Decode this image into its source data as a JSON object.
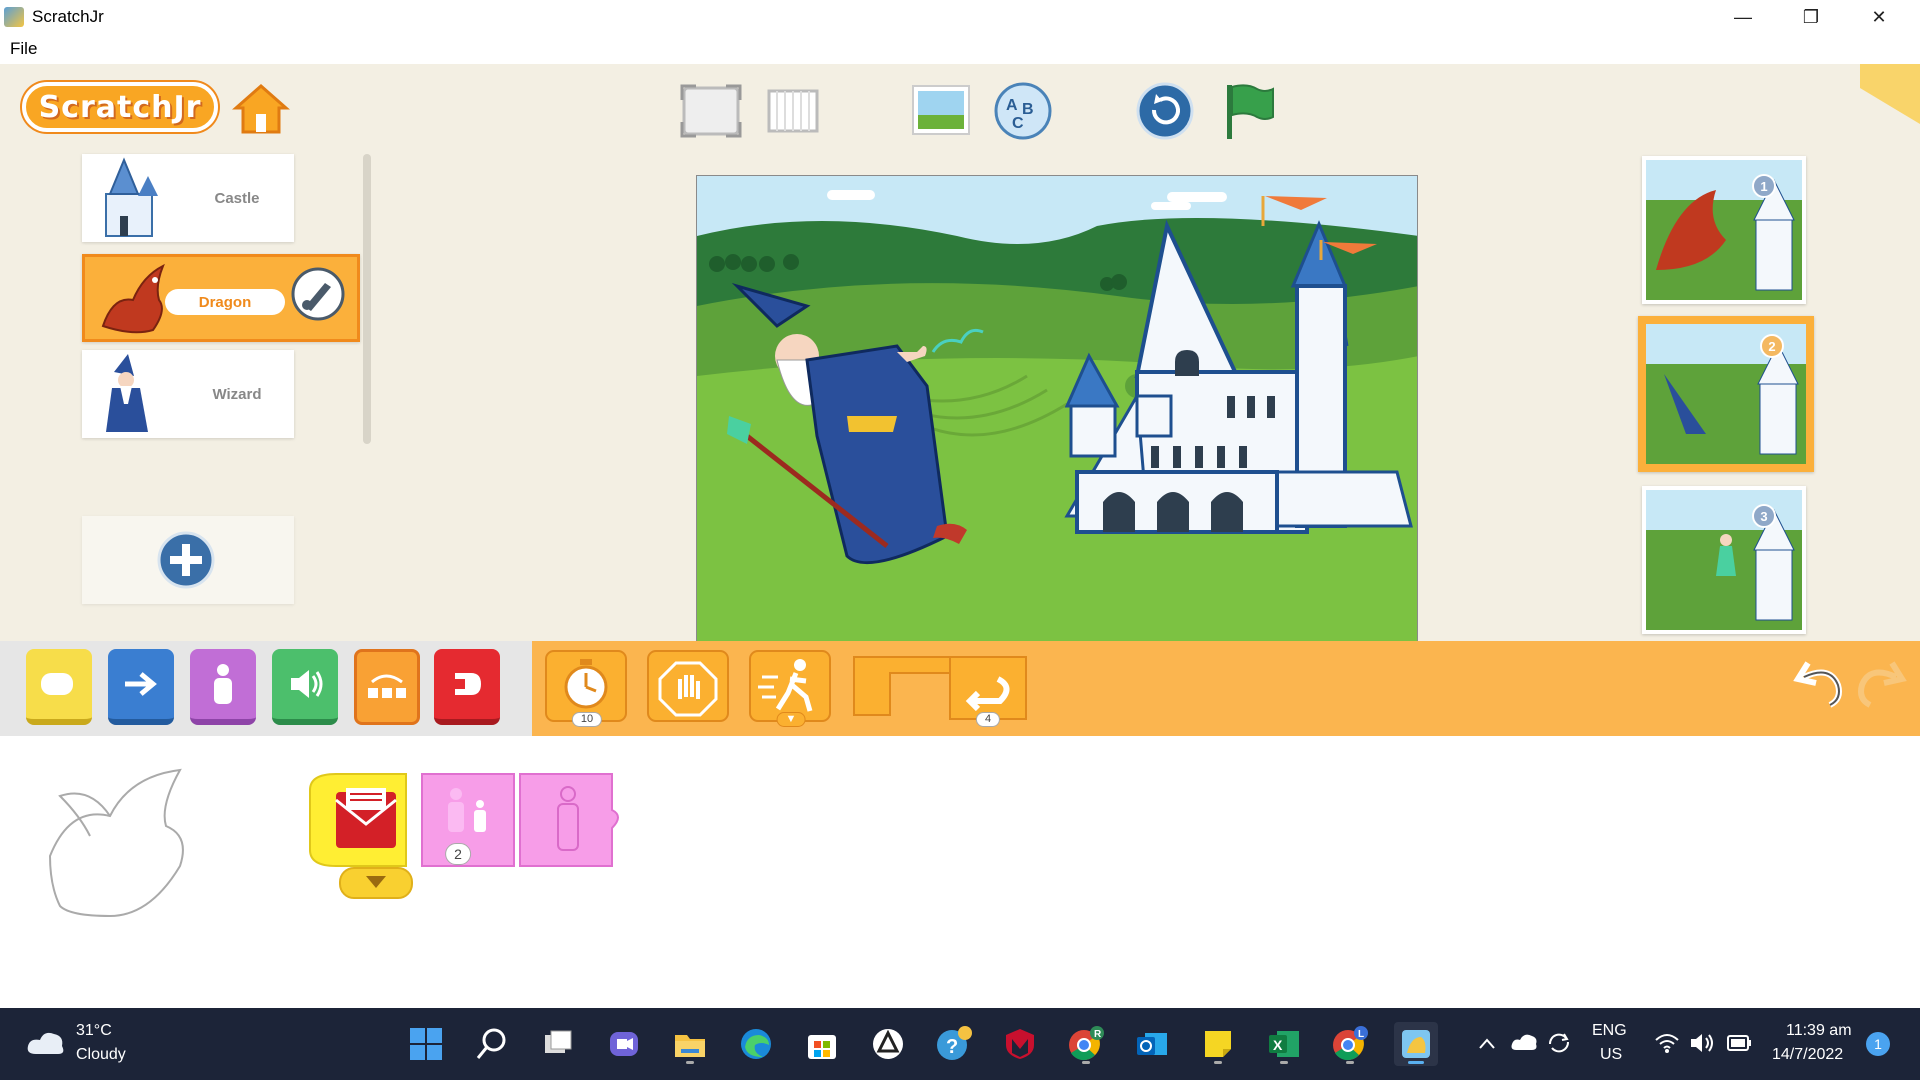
{
  "window": {
    "title": "ScratchJr",
    "minimize": "—",
    "maximize": "❐",
    "close": "✕"
  },
  "menu": {
    "file": "File"
  },
  "sprites": [
    {
      "label": "Castle",
      "selected": false
    },
    {
      "label": "Dragon",
      "selected": true
    },
    {
      "label": "Wizard",
      "selected": false
    }
  ],
  "pages": [
    {
      "number": "1"
    },
    {
      "number": "2",
      "selected": true
    },
    {
      "number": "3"
    }
  ],
  "palette": {
    "categories": [
      "triggering",
      "motion",
      "looks",
      "sound",
      "control",
      "end"
    ],
    "blocks": {
      "wait_value": "10",
      "repeat_value": "4"
    }
  },
  "script": {
    "size_value": "2"
  },
  "taskbar": {
    "weather_temp": "31°C",
    "weather_desc": "Cloudy",
    "lang_top": "ENG",
    "lang_bottom": "US",
    "time": "11:39 am",
    "date": "14/7/2022",
    "notifications": "1",
    "chrome_badge_r": "R",
    "chrome_badge_l": "L"
  },
  "colors": {
    "accent_orange": "#fbb54f",
    "taskbar": "#1c2438",
    "stage_sky": "#c7e8f6",
    "stage_grass": "#7cc242"
  }
}
